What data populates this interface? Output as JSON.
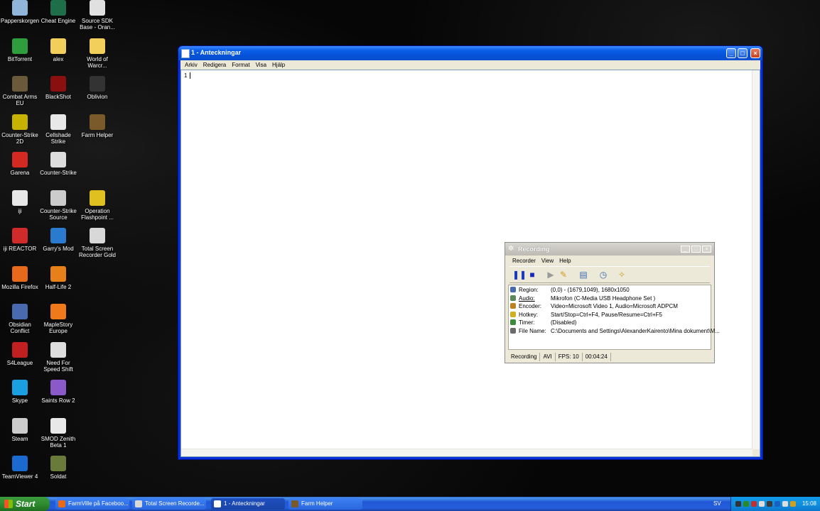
{
  "desktop_icons": [
    {
      "label": "Papperskorgen",
      "icon": "recycle-bin-icon",
      "color": "#8fb5d8"
    },
    {
      "label": "Cheat Engine",
      "icon": "cheat-engine-icon",
      "color": "#1f6e4a"
    },
    {
      "label": "Source SDK Base - Oran...",
      "icon": "source-sdk-icon",
      "color": "#e0e0e0"
    },
    {
      "label": "BitTorrent",
      "icon": "bittorrent-icon",
      "color": "#2e9e3c"
    },
    {
      "label": "alex",
      "icon": "folder-icon",
      "color": "#f2cf5a"
    },
    {
      "label": "World of Warcr...",
      "icon": "folder-icon",
      "color": "#f2cf5a"
    },
    {
      "label": "Combat Arms EU",
      "icon": "combat-arms-icon",
      "color": "#6b5a3a"
    },
    {
      "label": "BlackShot",
      "icon": "blackshot-icon",
      "color": "#8a1010"
    },
    {
      "label": "Oblivion",
      "icon": "oblivion-icon",
      "color": "#333333"
    },
    {
      "label": "Counter-Strike 2D",
      "icon": "counter-strike-2d-icon",
      "color": "#c8b200"
    },
    {
      "label": "Cellshade Strike",
      "icon": "document-icon",
      "color": "#e8e8e8"
    },
    {
      "label": "Farm Helper",
      "icon": "farm-helper-icon",
      "color": "#7a5a2a"
    },
    {
      "label": "Garena",
      "icon": "garena-icon",
      "color": "#d22a20"
    },
    {
      "label": "Counter-Strike",
      "icon": "counter-strike-icon",
      "color": "#dddddd"
    },
    {
      "label": "iji",
      "icon": "iji-icon",
      "color": "#e8e8e8"
    },
    {
      "label": "Counter-Strike Source",
      "icon": "counter-strike-source-icon",
      "color": "#cccccc"
    },
    {
      "label": "Operation Flashpoint ...",
      "icon": "operation-flashpoint-icon",
      "color": "#e0c020"
    },
    {
      "label": "iji REACTOR",
      "icon": "iji-reactor-icon",
      "color": "#d02a2a"
    },
    {
      "label": "Garry's Mod",
      "icon": "garrys-mod-icon",
      "color": "#2a7ad0"
    },
    {
      "label": "Total Screen Recorder Gold",
      "icon": "total-screen-recorder-icon",
      "color": "#d8d8d8"
    },
    {
      "label": "Mozilla Firefox",
      "icon": "firefox-icon",
      "color": "#e66a1a"
    },
    {
      "label": "Half-Life 2",
      "icon": "half-life-2-icon",
      "color": "#e8801a"
    },
    {
      "label": "Obsidian Conflict",
      "icon": "obsidian-conflict-icon",
      "color": "#4a6ab0"
    },
    {
      "label": "MapleStory Europe",
      "icon": "maplestory-icon",
      "color": "#f07a1a"
    },
    {
      "label": "S4League",
      "icon": "s4league-icon",
      "color": "#c02020"
    },
    {
      "label": "Need For Speed Shift",
      "icon": "need-for-speed-icon",
      "color": "#dddddd"
    },
    {
      "label": "Skype",
      "icon": "skype-icon",
      "color": "#1aa0e0"
    },
    {
      "label": "Saints Row 2",
      "icon": "saints-row-icon",
      "color": "#8a5ac8"
    },
    {
      "label": "Steam",
      "icon": "steam-icon",
      "color": "#cccccc"
    },
    {
      "label": "SMOD Zenith Beta 1",
      "icon": "document-icon",
      "color": "#e8e8e8"
    },
    {
      "label": "TeamViewer 4",
      "icon": "teamviewer-icon",
      "color": "#1a6ad0"
    },
    {
      "label": "Soldat",
      "icon": "soldat-icon",
      "color": "#6a7a3a"
    }
  ],
  "notepad": {
    "title": "1 - Anteckningar",
    "menu": [
      "Arkiv",
      "Redigera",
      "Format",
      "Visa",
      "Hjälp"
    ],
    "content": "1"
  },
  "recording": {
    "title": "Recording",
    "menu": [
      "Recorder",
      "View",
      "Help"
    ],
    "info": [
      {
        "key": "Region:",
        "value": "(0,0) - (1679,1049), 1680x1050",
        "icon_color": "#4a6ab0"
      },
      {
        "key": "Audio:",
        "value": "Mikrofon (C-Media USB Headphone Set  )",
        "icon_color": "#5a8a5a"
      },
      {
        "key": "Encoder:",
        "value": "Video=Microsoft Video 1, Audio=Microsoft ADPCM",
        "icon_color": "#c08020"
      },
      {
        "key": "Hotkey:",
        "value": "Start/Stop=Ctrl+F4, Pause/Resume=Ctrl+F5",
        "icon_color": "#d0b020"
      },
      {
        "key": "Timer:",
        "value": "(Disabled)",
        "icon_color": "#3a8a3a"
      },
      {
        "key": "File Name:",
        "value": "C:\\Documents and Settings\\AlexanderKairento\\Mina dokument\\M...",
        "icon_color": "#6a6a6a"
      }
    ],
    "status": [
      "Recording",
      "AVI",
      "FPS: 10",
      "00:04:24"
    ]
  },
  "taskbar": {
    "start_label": "Start",
    "tasks": [
      {
        "label": "FarmVille på Faceboo...",
        "icon_color": "#e66a1a"
      },
      {
        "label": "Total Screen Recorde...",
        "icon_color": "#d8d8d8"
      },
      {
        "label": "1 - Anteckningar",
        "icon_color": "#ffffff"
      },
      {
        "label": "Farm Helper",
        "icon_color": "#7a5a2a"
      }
    ],
    "language": "SV",
    "clock": "15:08"
  }
}
